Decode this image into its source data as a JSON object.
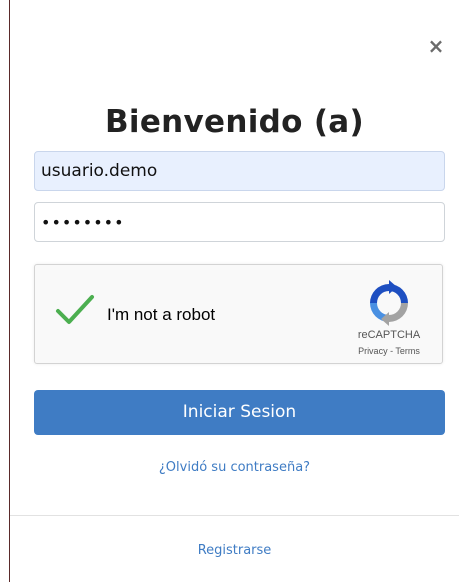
{
  "modal": {
    "close_icon": "×",
    "title": "Bienvenido (a)"
  },
  "form": {
    "username_value": "usuario.demo",
    "password_value": "••••••••"
  },
  "captcha": {
    "label": "I'm not a robot",
    "brand": "reCAPTCHA",
    "privacy": "Privacy",
    "separator": " - ",
    "terms": "Terms",
    "checked": true,
    "check_color": "#4caf50"
  },
  "actions": {
    "login_label": "Iniciar Sesion",
    "forgot_label": "¿Olvidó su contraseña?",
    "register_label": "Registrarse"
  },
  "colors": {
    "primary": "#3f7cc4",
    "autofill_bg": "#e8f0fe"
  }
}
